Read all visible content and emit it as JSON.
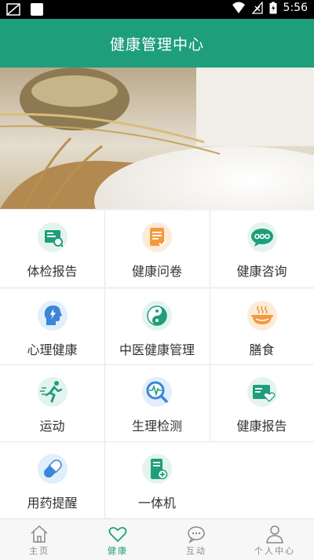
{
  "status_bar": {
    "time": "5:56"
  },
  "header": {
    "title": "健康管理中心"
  },
  "colors": {
    "accent": "#1f9e7c"
  },
  "top_menu": [
    {
      "label": "体检报告",
      "icon": "report-icon"
    },
    {
      "label": "健康问卷",
      "icon": "questionnaire-icon"
    },
    {
      "label": "健康咨询",
      "icon": "chat-icon"
    }
  ],
  "menu": [
    {
      "label": "心理健康",
      "icon": "head-icon"
    },
    {
      "label": "中医健康管理",
      "icon": "yin-yang-icon"
    },
    {
      "label": "膳食",
      "icon": "bowl-icon"
    },
    {
      "label": "运动",
      "icon": "runner-icon"
    },
    {
      "label": "生理检测",
      "icon": "pulse-magnifier-icon"
    },
    {
      "label": "健康报告",
      "icon": "heart-card-icon"
    },
    {
      "label": "用药提醒",
      "icon": "pill-icon"
    },
    {
      "label": "一体机",
      "icon": "device-icon"
    }
  ],
  "tabs": [
    {
      "label": "主页",
      "icon": "home-icon",
      "active": false
    },
    {
      "label": "健康",
      "icon": "heart-icon",
      "active": true
    },
    {
      "label": "互动",
      "icon": "chat-bubble-icon",
      "active": false
    },
    {
      "label": "个人中心",
      "icon": "person-icon",
      "active": false
    }
  ]
}
